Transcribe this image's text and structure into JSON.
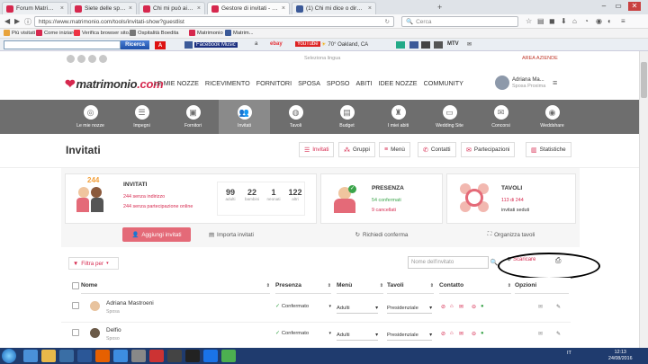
{
  "browser": {
    "tabs": [
      {
        "title": "Forum Matrimonio.com",
        "active": false,
        "fav": "#d6284e"
      },
      {
        "title": "Siete delle spose alle modi...",
        "active": false,
        "fav": "#d6284e"
      },
      {
        "title": "Chi mi può aiutare? - Foru...",
        "active": false,
        "fav": "#d6284e"
      },
      {
        "title": "Gestore di invitati - Matrim...",
        "active": true,
        "fav": "#d6284e"
      },
      {
        "title": "(1) Chi mi dice o dirsc?",
        "active": false,
        "fav": "#3b5998"
      }
    ],
    "new_tab": "+",
    "url": "https://www.matrimonio.com/tools/invitati-show?guestlist",
    "search_placeholder": "Cerca",
    "bookmarks": [
      "Più visitati",
      "Come iniziare",
      "Verifica browser sito...",
      "Ospitalità Boedita",
      "Matrimonio",
      "Matrim..."
    ],
    "toolbar_search_label": "Ricerca",
    "toolbar_items": [
      "Facebook Music",
      "ebay",
      "YouTube",
      "70° Oakland, CA",
      "MTV"
    ]
  },
  "site": {
    "top_center": "Seleziona lingua",
    "top_right": "AREA AZIENDE",
    "logo_text": "matrimonio",
    "logo_suffix": ".com",
    "nav": [
      "LE MIE NOZZE",
      "RICEVIMENTO",
      "FORNITORI",
      "SPOSA",
      "SPOSO",
      "ABITI",
      "IDEE NOZZE",
      "COMMUNITY"
    ],
    "user_name": "Adriana Ma...",
    "user_role": "Sposa Proxima"
  },
  "iconbar": [
    {
      "label": "Le mie nozze",
      "icon": "rings-icon",
      "glyph": "◎",
      "active": false
    },
    {
      "label": "Impegni",
      "icon": "checklist-icon",
      "glyph": "☰",
      "active": false
    },
    {
      "label": "Fornitori",
      "icon": "vendors-icon",
      "glyph": "▣",
      "active": false
    },
    {
      "label": "Invitati",
      "icon": "guests-icon",
      "glyph": "👥",
      "active": true
    },
    {
      "label": "Tavoli",
      "icon": "tables-icon",
      "glyph": "◍",
      "active": false
    },
    {
      "label": "Budget",
      "icon": "budget-icon",
      "glyph": "▤",
      "active": false
    },
    {
      "label": "I miei abiti",
      "icon": "dress-icon",
      "glyph": "♜",
      "active": false
    },
    {
      "label": "Wedding Site",
      "icon": "website-icon",
      "glyph": "▭",
      "active": false
    },
    {
      "label": "Concorsi",
      "icon": "contest-icon",
      "glyph": "✉",
      "active": false
    },
    {
      "label": "Weddshare",
      "icon": "camera-icon",
      "glyph": "◉",
      "active": false
    }
  ],
  "page": {
    "title": "Invitati",
    "subtabs": [
      {
        "label": "Invitati",
        "icon": "list-icon",
        "glyph": "☰",
        "active": true
      },
      {
        "label": "Gruppi",
        "icon": "groups-icon",
        "glyph": "⁂",
        "active": false
      },
      {
        "label": "Menù",
        "icon": "menu-icon",
        "glyph": "≡",
        "active": false
      },
      {
        "label": "Contatti",
        "icon": "contacts-icon",
        "glyph": "✆",
        "active": false
      },
      {
        "label": "Partecipazioni",
        "icon": "invitations-icon",
        "glyph": "✉",
        "active": false
      },
      {
        "label": "Statistiche",
        "icon": "stats-icon",
        "glyph": "▥",
        "active": false
      }
    ]
  },
  "summary": {
    "invitati": {
      "count": "244",
      "title": "INVITATI",
      "line1": "244 senza indirizzo",
      "line2": "244 senza partecipazione online",
      "stats": [
        {
          "n": "99",
          "l": "adulti"
        },
        {
          "n": "22",
          "l": "bambini"
        },
        {
          "n": "1",
          "l": "neonati"
        },
        {
          "n": "122",
          "l": "altri"
        }
      ],
      "button": "Aggiungi invitati",
      "import": "Importa invitati"
    },
    "presenza": {
      "title": "PRESENZA",
      "line1": "54 confermati",
      "line2": "9 cancellati",
      "button": "Richiedi conferma"
    },
    "tavoli": {
      "title": "TAVOLI",
      "line1": "113 di 244",
      "line2": "invitati seduti",
      "button": "Organizza tavoli"
    }
  },
  "filters": {
    "filter_label": "Filtra per",
    "search_placeholder": "Nome dell'invitato",
    "download": "Scaricare"
  },
  "table": {
    "headers": [
      "Nome",
      "Presenza",
      "Menù",
      "Tavoli",
      "Contatto",
      "Opzioni"
    ],
    "rows": [
      {
        "name": "Adriana Mastroeni",
        "role": "Sposa",
        "presence": "Confermato",
        "menu": "Adulti",
        "table": "Presidenziale",
        "avatar": "#e8c39e"
      },
      {
        "name": "Delfio",
        "role": "Sposo",
        "presence": "Confermato",
        "menu": "Adulti",
        "table": "Presidenziale",
        "avatar": "#6b5a48"
      }
    ]
  },
  "taskbar": {
    "lang": "IT",
    "time": "12:13",
    "date": "24/08/2016"
  }
}
